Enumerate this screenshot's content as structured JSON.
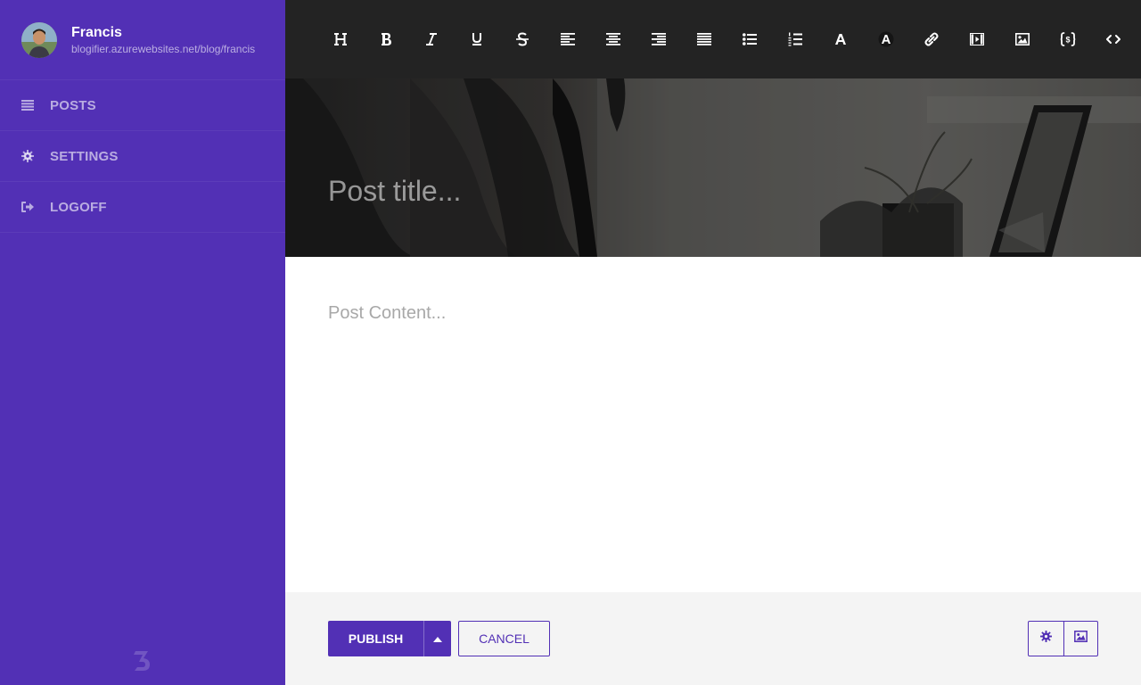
{
  "colors": {
    "brand": "#5230b5",
    "toolbar": "#232323",
    "footer": "#f4f4f4"
  },
  "profile": {
    "name": "Francis",
    "url": "blogifier.azurewebsites.net/blog/francis"
  },
  "nav": [
    {
      "label": "POSTS",
      "icon": "list-icon"
    },
    {
      "label": "SETTINGS",
      "icon": "gear-icon"
    },
    {
      "label": "LOGOFF",
      "icon": "sign-out-icon"
    }
  ],
  "toolbar": [
    "heading-icon",
    "bold-icon",
    "italic-icon",
    "underline-icon",
    "strikethrough-icon",
    "align-left-icon",
    "align-center-icon",
    "align-right-icon",
    "align-justify-icon",
    "bullet-list-icon",
    "numbered-list-icon",
    "text-color-icon",
    "highlight-color-icon",
    "link-icon",
    "video-icon",
    "image-icon",
    "code-icon",
    "source-icon"
  ],
  "editor": {
    "title_placeholder": "Post title...",
    "content_placeholder": "Post Content..."
  },
  "footer": {
    "publish_label": "PUBLISH",
    "cancel_label": "CANCEL"
  }
}
